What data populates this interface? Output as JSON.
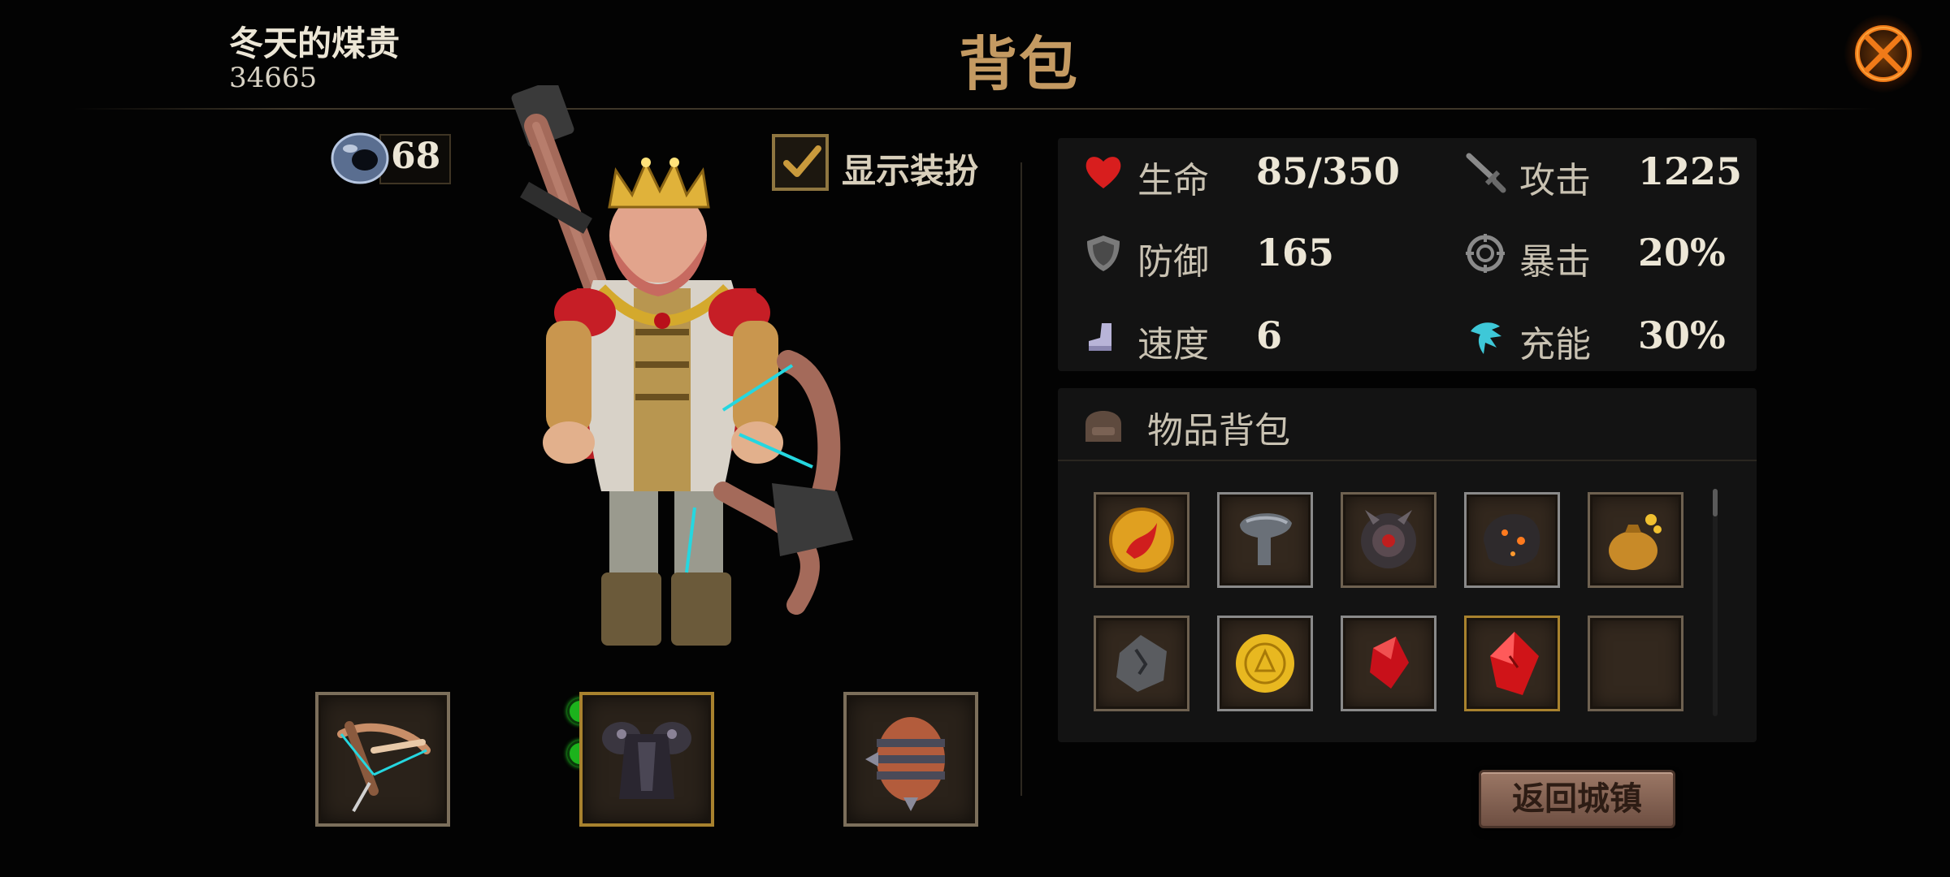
{
  "header": {
    "player_name": "冬天的煤贵",
    "player_id": "34665",
    "title": "背包",
    "close_icon": "close-x-icon"
  },
  "character": {
    "currency_count": "68",
    "currency_icon": "gem-ring-icon",
    "show_outfit_label": "显示装扮",
    "show_outfit_checked": true
  },
  "equipment": [
    {
      "slot": "weapon",
      "icon": "crossbow-icon"
    },
    {
      "slot": "armor",
      "icon": "dark-armor-icon",
      "sockets": 2
    },
    {
      "slot": "trinket",
      "icon": "spiked-barrel-icon"
    }
  ],
  "stats": {
    "hp": {
      "label": "生命",
      "value": "85/350",
      "icon": "heart-icon"
    },
    "atk": {
      "label": "攻击",
      "value": "1225",
      "icon": "sword-icon"
    },
    "def": {
      "label": "防御",
      "value": "165",
      "icon": "shield-icon"
    },
    "crit": {
      "label": "暴击",
      "value": "20%",
      "icon": "crit-target-icon"
    },
    "speed": {
      "label": "速度",
      "value": "6",
      "icon": "boot-icon"
    },
    "charge": {
      "label": "充能",
      "value": "30%",
      "icon": "energy-wing-icon"
    }
  },
  "inventory": {
    "title": "物品背包",
    "icon": "bag-icon",
    "items": [
      {
        "icon": "fire-coin-icon"
      },
      {
        "icon": "helmet-icon"
      },
      {
        "icon": "demon-shield-icon"
      },
      {
        "icon": "lava-rock-icon"
      },
      {
        "icon": "gold-pouch-icon"
      },
      {
        "icon": "stone-rune-icon"
      },
      {
        "icon": "gold-coin-icon"
      },
      {
        "icon": "red-crystal-icon"
      },
      {
        "icon": "red-crystal-large-icon"
      },
      {
        "icon": "empty-slot"
      }
    ]
  },
  "return_button": {
    "label": "返回城镇"
  },
  "colors": {
    "title_gold": "#c49a62",
    "panel_bg": "#131313",
    "page_bg": "#030303",
    "heart_red": "#d81e1e",
    "button_clay": "#8a6656"
  }
}
